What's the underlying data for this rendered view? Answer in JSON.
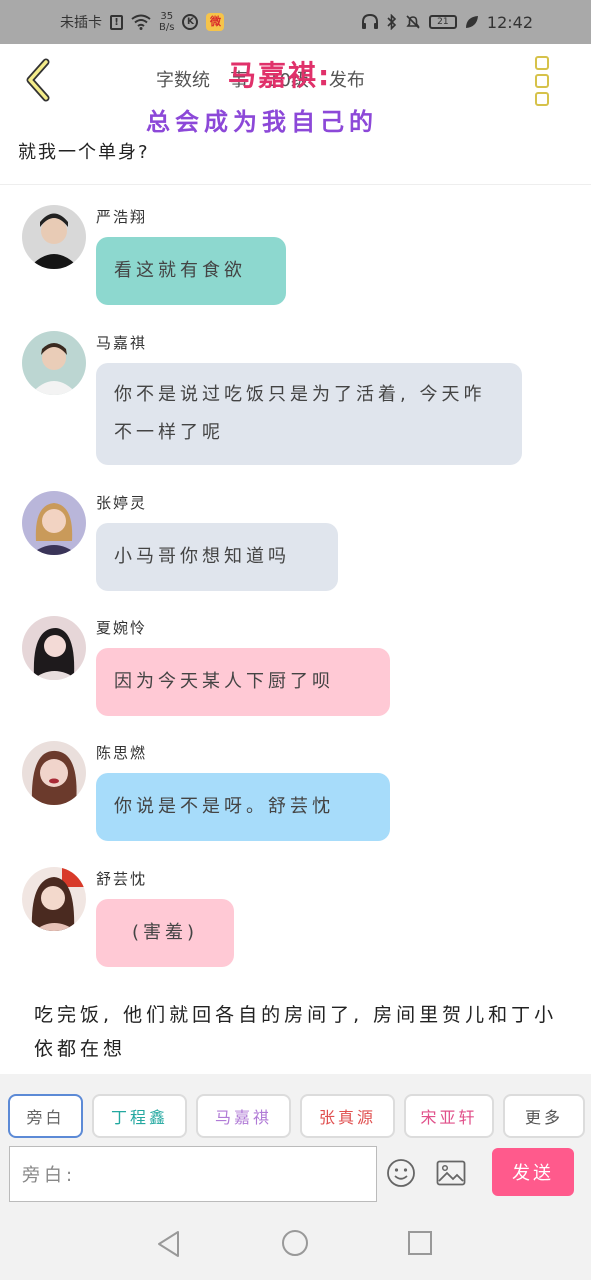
{
  "status_bar": {
    "carrier": "未插卡",
    "sim_icon": "!",
    "speed_value": "35",
    "speed_unit": "B/s",
    "k_icon": "K",
    "weibo_icon": "微",
    "battery": "21",
    "time": "12:42"
  },
  "header": {
    "toolbar_items": [
      "字数统",
      "事",
      "10级",
      "发布"
    ],
    "overlay_name": "马嘉祺:",
    "overlay_slogan": "总会成为我自己的",
    "question": "就我一个单身?"
  },
  "messages": [
    {
      "sender": "严浩翔",
      "text": "看这就有食欲",
      "bubble_color": "#8dd8cf"
    },
    {
      "sender": "马嘉祺",
      "text": "你不是说过吃饭只是为了活着, 今天咋不一样了呢",
      "bubble_color": "#e0e5ed"
    },
    {
      "sender": "张婷灵",
      "text": "小马哥你想知道吗",
      "bubble_color": "#e0e5ed"
    },
    {
      "sender": "夏婉怜",
      "text": "因为今天某人下厨了呗",
      "bubble_color": "#ffc9d5"
    },
    {
      "sender": "陈思燃",
      "text": "你说是不是呀。舒芸忱",
      "bubble_color": "#a7dcfa"
    },
    {
      "sender": "舒芸忱",
      "text": "(害羞)",
      "bubble_color": "#ffc9d5"
    }
  ],
  "narration": "吃完饭, 他们就回各自的房间了, 房间里贺儿和丁小依都在想",
  "composer": {
    "chips": [
      {
        "label": "旁白",
        "color": "#666666"
      },
      {
        "label": "丁程鑫",
        "color": "#23a8a0"
      },
      {
        "label": "马嘉祺",
        "color": "#b07ad6"
      },
      {
        "label": "张真源",
        "color": "#e05050"
      },
      {
        "label": "宋亚轩",
        "color": "#e0508a"
      },
      {
        "label": "更多",
        "color": "#555555"
      }
    ],
    "input_placeholder": "旁白:",
    "send_label": "发送"
  }
}
